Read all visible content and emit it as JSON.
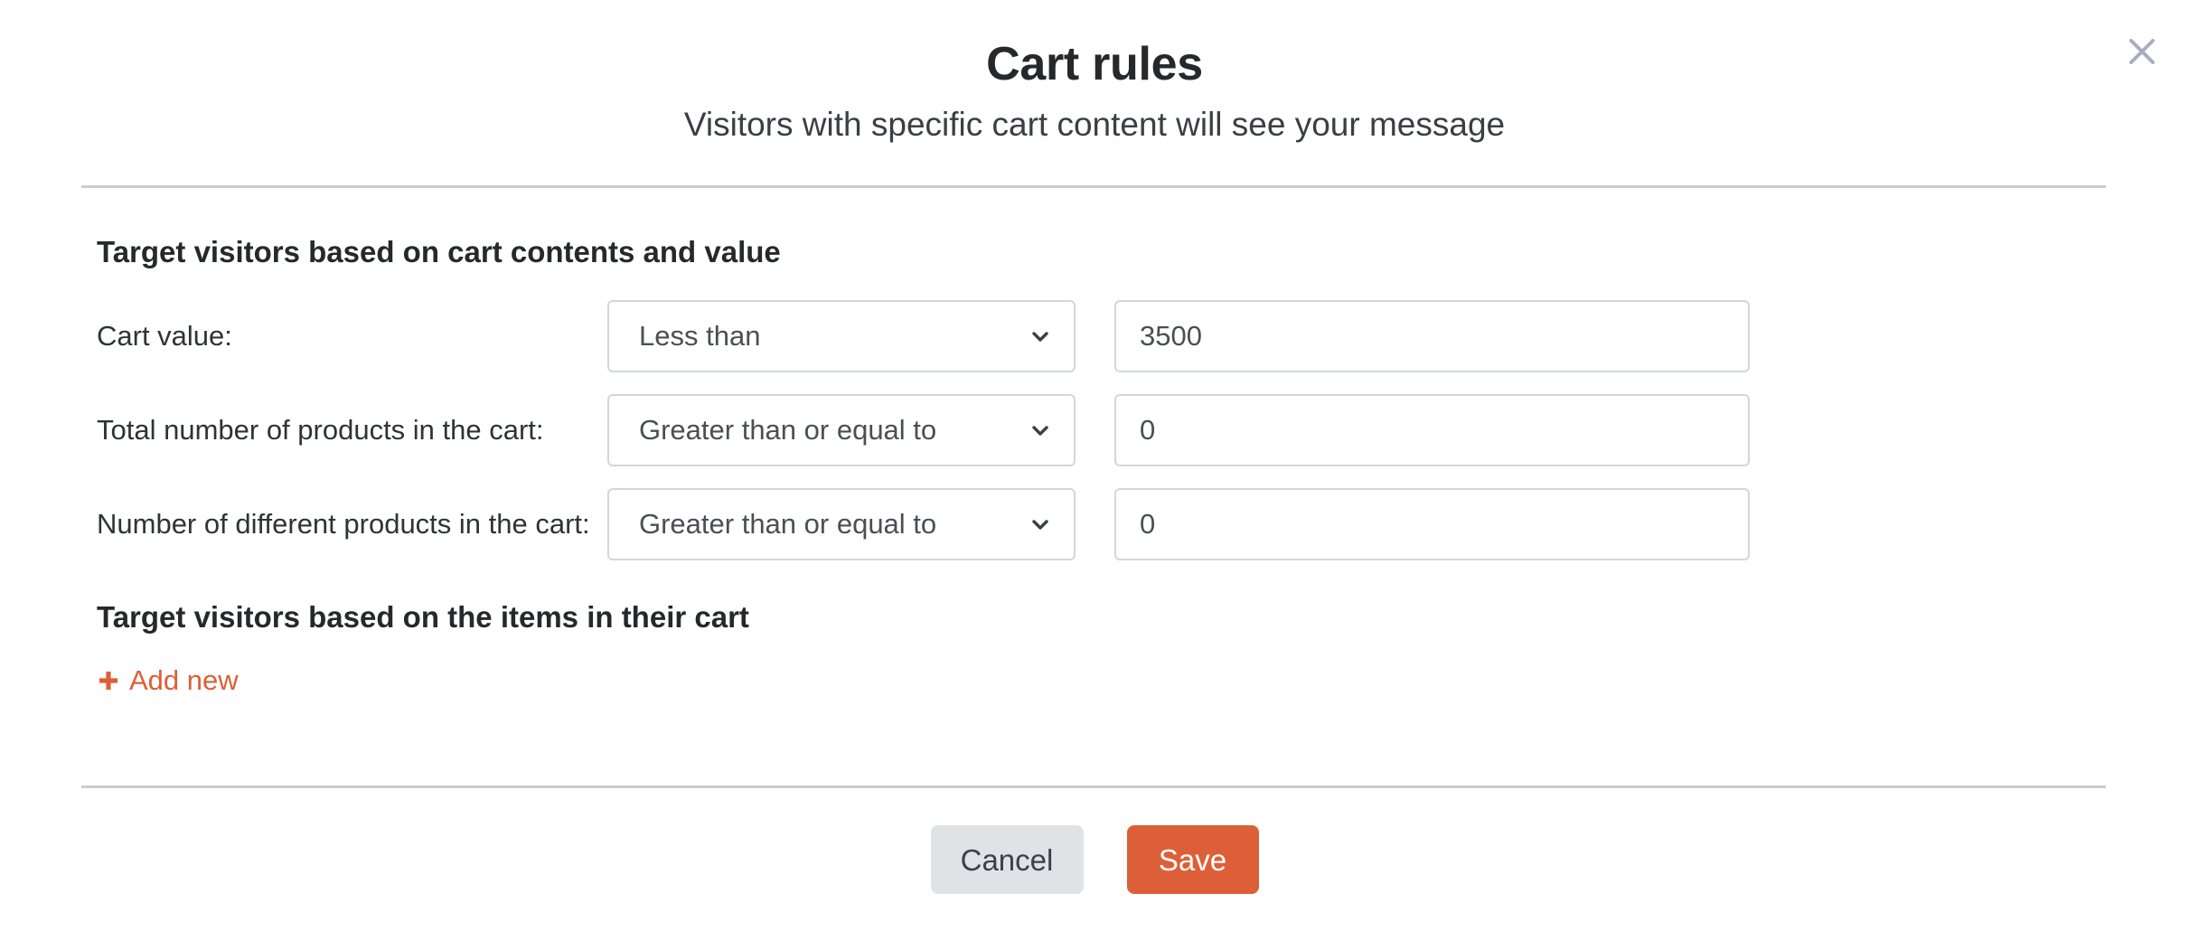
{
  "modal": {
    "title": "Cart rules",
    "subtitle": "Visitors with specific cart content will see your message",
    "close_icon": "close-icon"
  },
  "sections": {
    "cart_contents": {
      "heading": "Target visitors based on cart contents and value",
      "rows": [
        {
          "label": "Cart value:",
          "operator": "Less than",
          "value": "3500",
          "placeholder": ""
        },
        {
          "label": "Total number of products in the cart:",
          "operator": "Greater than or equal to",
          "value": "0",
          "placeholder": ""
        },
        {
          "label": "Number of different products in the cart:",
          "operator": "Greater than or equal to",
          "value": "0",
          "placeholder": ""
        }
      ]
    },
    "cart_items": {
      "heading": "Target visitors based on the items in their cart",
      "add_new_label": "Add new",
      "add_new_icon": "plus-icon"
    }
  },
  "footer": {
    "cancel_label": "Cancel",
    "save_label": "Save"
  },
  "colors": {
    "accent": "#dd5f37",
    "cancel_bg": "#e0e2e6",
    "border": "#d3d6de",
    "divider": "#cbcbcb",
    "text": "#2f3337"
  }
}
